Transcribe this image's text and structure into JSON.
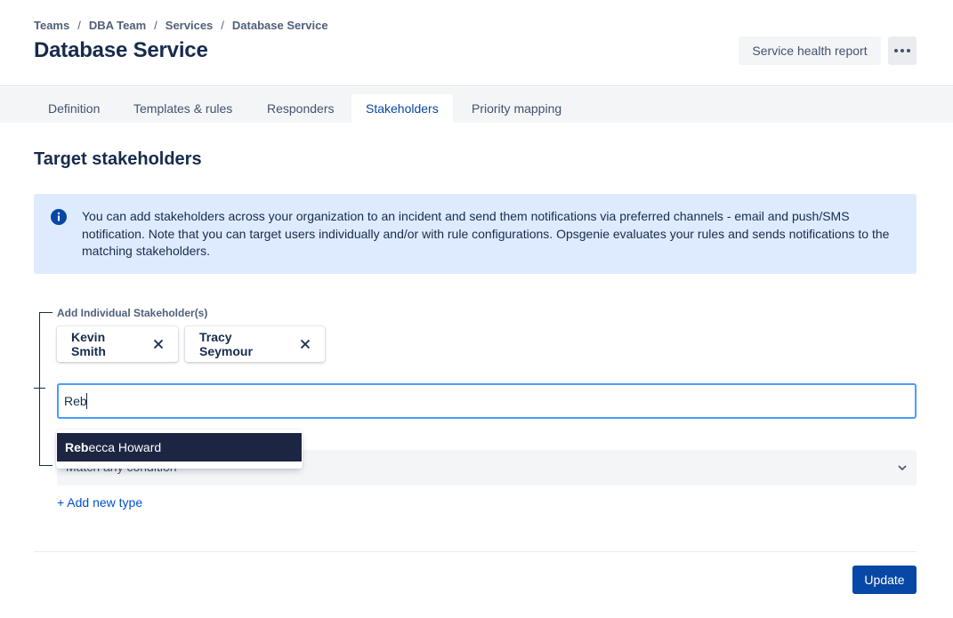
{
  "breadcrumb": {
    "items": [
      "Teams",
      "DBA Team",
      "Services",
      "Database Service"
    ],
    "separator": "/"
  },
  "header": {
    "title": "Database Service",
    "health_report_label": "Service health report",
    "more_icon": "more-horizontal-icon"
  },
  "tabs": [
    {
      "label": "Definition",
      "active": false
    },
    {
      "label": "Templates & rules",
      "active": false
    },
    {
      "label": "Responders",
      "active": false
    },
    {
      "label": "Stakeholders",
      "active": true
    },
    {
      "label": "Priority mapping",
      "active": false
    }
  ],
  "section": {
    "title": "Target stakeholders"
  },
  "info": {
    "icon": "info-icon",
    "text": "You can add stakeholders across your organization to an incident and send them notifications via preferred channels - email and push/SMS notification. Note that you can target users individually and/or with rule configurations. Opsgenie evaluates your rules and sends notifications to the matching stakeholders."
  },
  "stakeholders": {
    "label": "Add Individual Stakeholder(s)",
    "chips": [
      "Kevin Smith",
      "Tracy Seymour"
    ],
    "search_value": "Reb",
    "suggestion": {
      "match": "Reb",
      "rest": "ecca Howard"
    }
  },
  "condition": {
    "selected": "Match any condition"
  },
  "actions": {
    "add_type_label": "+ Add new type",
    "update_label": "Update"
  },
  "colors": {
    "primary": "#0747a6",
    "link": "#0052cc",
    "info_bg": "#deebff",
    "focus_border": "#4c9aff",
    "dropdown_highlight": "#1c2642"
  }
}
